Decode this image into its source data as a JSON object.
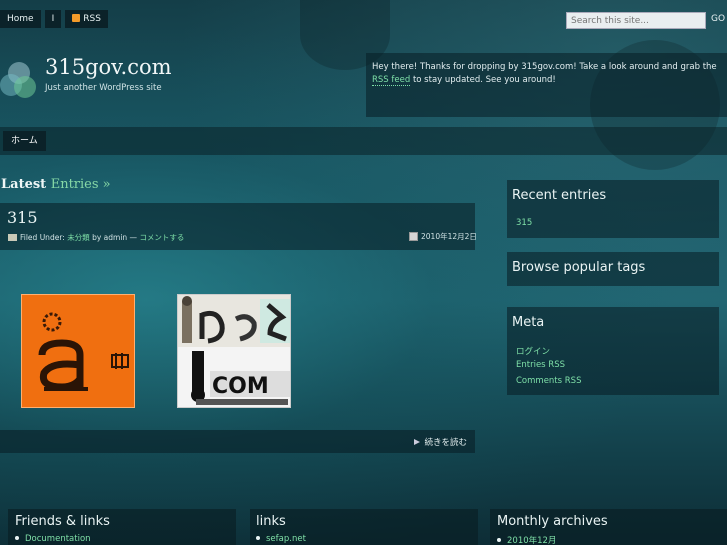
{
  "topnav": {
    "home": "Home",
    "separator": "I",
    "rss": "RSS"
  },
  "search": {
    "placeholder": "Search this site...",
    "go": "GO"
  },
  "header": {
    "title": "315gov.com",
    "description": "Just another WordPress site",
    "welcome_pre": "Hey there! Thanks for dropping by 315gov.com! Take a look around and grab the ",
    "welcome_link": "RSS feed",
    "welcome_post": " to stay updated. See you around!"
  },
  "menu": {
    "item": "ホーム"
  },
  "main": {
    "latest_label": "Latest",
    "latest_accent": "Entries »",
    "post": {
      "title": "315",
      "filed_under": "Filed Under:",
      "category": "未分類",
      "by": "by admin —",
      "comments": "コメントする",
      "date": "2010年12月2日",
      "read_more": "続きを読む"
    }
  },
  "sidebar": {
    "recent_title": "Recent entries",
    "recent_item": "315",
    "tags_title": "Browse popular tags",
    "meta_title": "Meta",
    "meta_items": [
      "ログイン",
      "Entries RSS",
      "Comments RSS"
    ]
  },
  "footer": {
    "friends_title": "Friends & links",
    "friends_item": "Documentation",
    "links_title": "links",
    "links_item": "sefap.net",
    "archives_title": "Monthly archives",
    "archives_item": "2010年12月"
  },
  "colors": {
    "accent": "#7fe0a8",
    "bg": "#1a5663",
    "panel": "#0b2229"
  }
}
